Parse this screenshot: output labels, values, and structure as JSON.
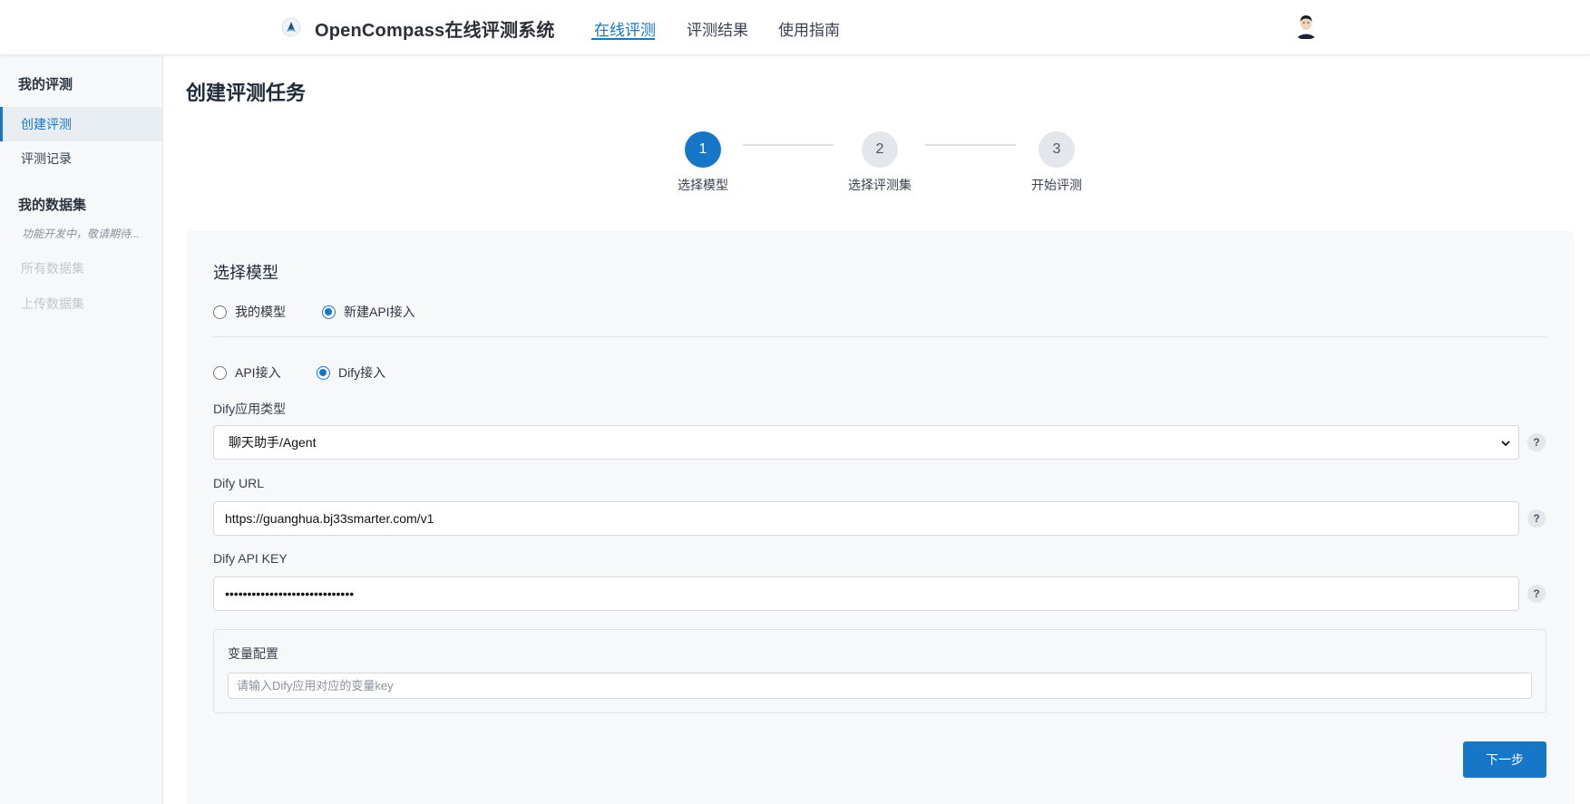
{
  "header": {
    "brand": "OpenCompass在线评测系统",
    "nav": [
      {
        "label": "在线评测",
        "active": true
      },
      {
        "label": "评测结果",
        "active": false
      },
      {
        "label": "使用指南",
        "active": false
      }
    ],
    "logo_icon": "compass-logo-icon",
    "avatar_icon": "user-avatar-icon"
  },
  "sidebar": {
    "section1_title": "我的评测",
    "items": [
      {
        "label": "创建评测",
        "active": true
      },
      {
        "label": "评测记录",
        "active": false
      }
    ],
    "section2_title": "我的数据集",
    "note": "功能开发中，敬请期待...",
    "disabled_items": [
      "所有数据集",
      "上传数据集"
    ]
  },
  "main": {
    "page_title": "创建评测任务",
    "steps": [
      {
        "number": "1",
        "label": "选择模型",
        "active": true
      },
      {
        "number": "2",
        "label": "选择评测集",
        "active": false
      },
      {
        "number": "3",
        "label": "开始评测",
        "active": false
      }
    ],
    "card": {
      "title": "选择模型",
      "model_source": {
        "options": [
          "我的模型",
          "新建API接入"
        ],
        "selected": "新建API接入"
      },
      "access_type": {
        "options": [
          "API接入",
          "Dify接入"
        ],
        "selected": "Dify接入"
      },
      "dify_type": {
        "label": "Dify应用类型",
        "value": "聊天助手/Agent"
      },
      "dify_url": {
        "label": "Dify URL",
        "value": "https://guanghua.bj33smarter.com/v1"
      },
      "dify_key": {
        "label": "Dify API KEY",
        "value": "•••••••••••••••••••••••••••••"
      },
      "help_glyph": "?",
      "variables": {
        "title": "变量配置",
        "placeholder": "请输入Dify应用对应的变量key"
      },
      "next_label": "下一步"
    }
  },
  "colors": {
    "accent": "#1677c8",
    "sidebar_bg": "#f6f8fa"
  }
}
